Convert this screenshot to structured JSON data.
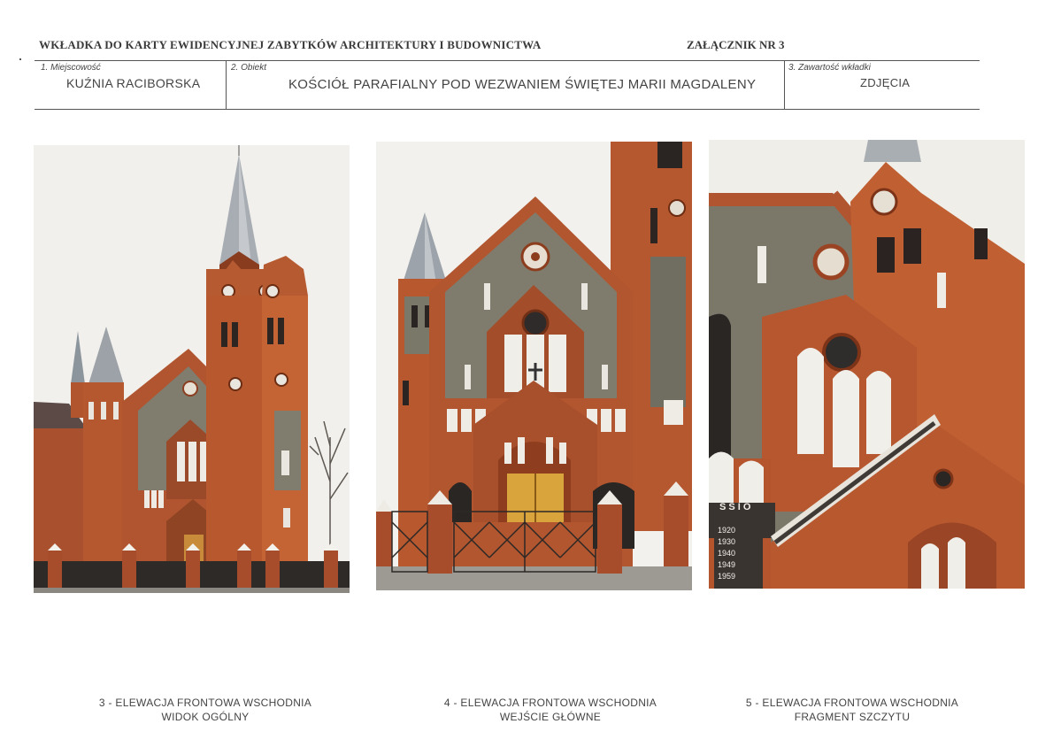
{
  "header": {
    "title": "WKŁADKA DO KARTY EWIDENCYJNEJ ZABYTKÓW ARCHITEKTURY I BUDOWNICTWA",
    "attachment": "ZAŁĄCZNIK NR 3"
  },
  "fields": {
    "location_label": "1. Miejscowość",
    "location_value": "KUŹNIA RACIBORSKA",
    "object_label": "2. Obiekt",
    "object_value": "KOŚCIÓŁ PARAFIALNY POD WEZWANIEM ŚWIĘTEJ MARII MAGDALENY",
    "contents_label": "3. Zawartość wkładki",
    "contents_value": "ZDJĘCIA"
  },
  "photos": [
    {
      "line1": "3 - ELEWACJA FRONTOWA WSCHODNIA",
      "line2": "WIDOK OGÓLNY"
    },
    {
      "line1": "4 - ELEWACJA FRONTOWA WSCHODNIA",
      "line2": "WEJŚCIE GŁÓWNE"
    },
    {
      "line1": "5 - ELEWACJA FRONTOWA WSCHODNIA",
      "line2": "FRAGMENT SZCZYTU"
    }
  ],
  "plaque_years": [
    "1920",
    "1930",
    "1940",
    "1949",
    "1959"
  ],
  "colors": {
    "brick": "#b5542c",
    "plaster": "#7d7a6c",
    "sky": "#f1f0ec",
    "roof": "#a8adb3"
  }
}
